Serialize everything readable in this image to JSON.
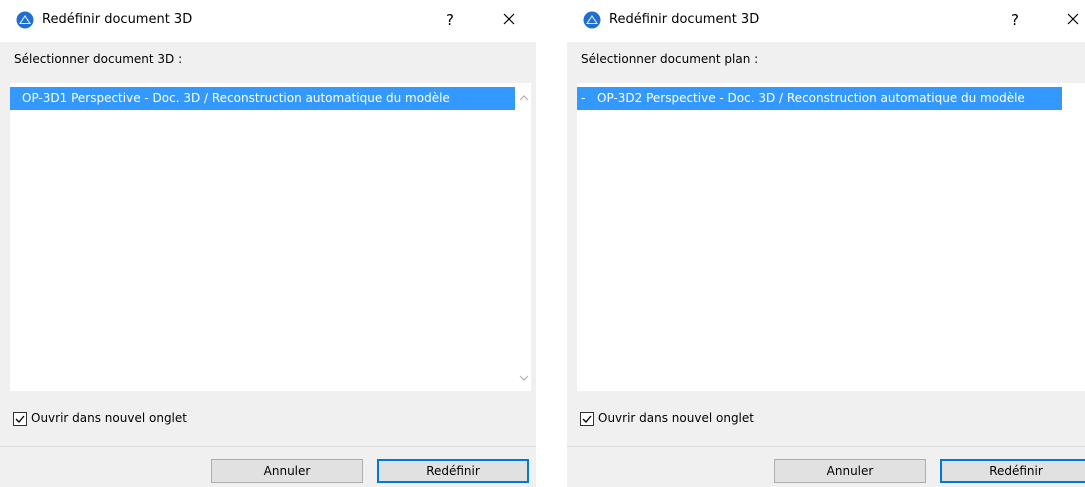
{
  "dialogs": [
    {
      "title": "Redéfinir document 3D",
      "help_label": "?",
      "section_label": "Sélectionner document 3D :",
      "list_items": [
        {
          "prefix": "",
          "label": "OP-3D1 Perspective - Doc. 3D / Reconstruction automatique du modèle",
          "selected": true
        }
      ],
      "checkbox": {
        "label": "Ouvrir dans nouvel onglet",
        "checked": true
      },
      "buttons": {
        "cancel": "Annuler",
        "ok": "Redéfinir"
      }
    },
    {
      "title": "Redéfinir document 3D",
      "help_label": "?",
      "section_label": "Sélectionner document plan :",
      "list_items": [
        {
          "prefix": "-",
          "label": "OP-3D2 Perspective - Doc. 3D / Reconstruction automatique du modèle",
          "selected": true
        }
      ],
      "checkbox": {
        "label": "Ouvrir dans nouvel onglet",
        "checked": true
      },
      "buttons": {
        "cancel": "Annuler",
        "ok": "Redéfinir"
      }
    }
  ],
  "colors": {
    "selection": "#3399ff",
    "dialog_bg": "#f0f0f0",
    "default_button_border": "#0078d7",
    "app_icon_blue": "#1f6fd1"
  },
  "icons": {
    "app": "archicad-icon",
    "close": "close-icon",
    "checkbox": "checkmark-icon",
    "scroll_up": "chevron-up-icon",
    "scroll_down": "chevron-down-icon"
  }
}
